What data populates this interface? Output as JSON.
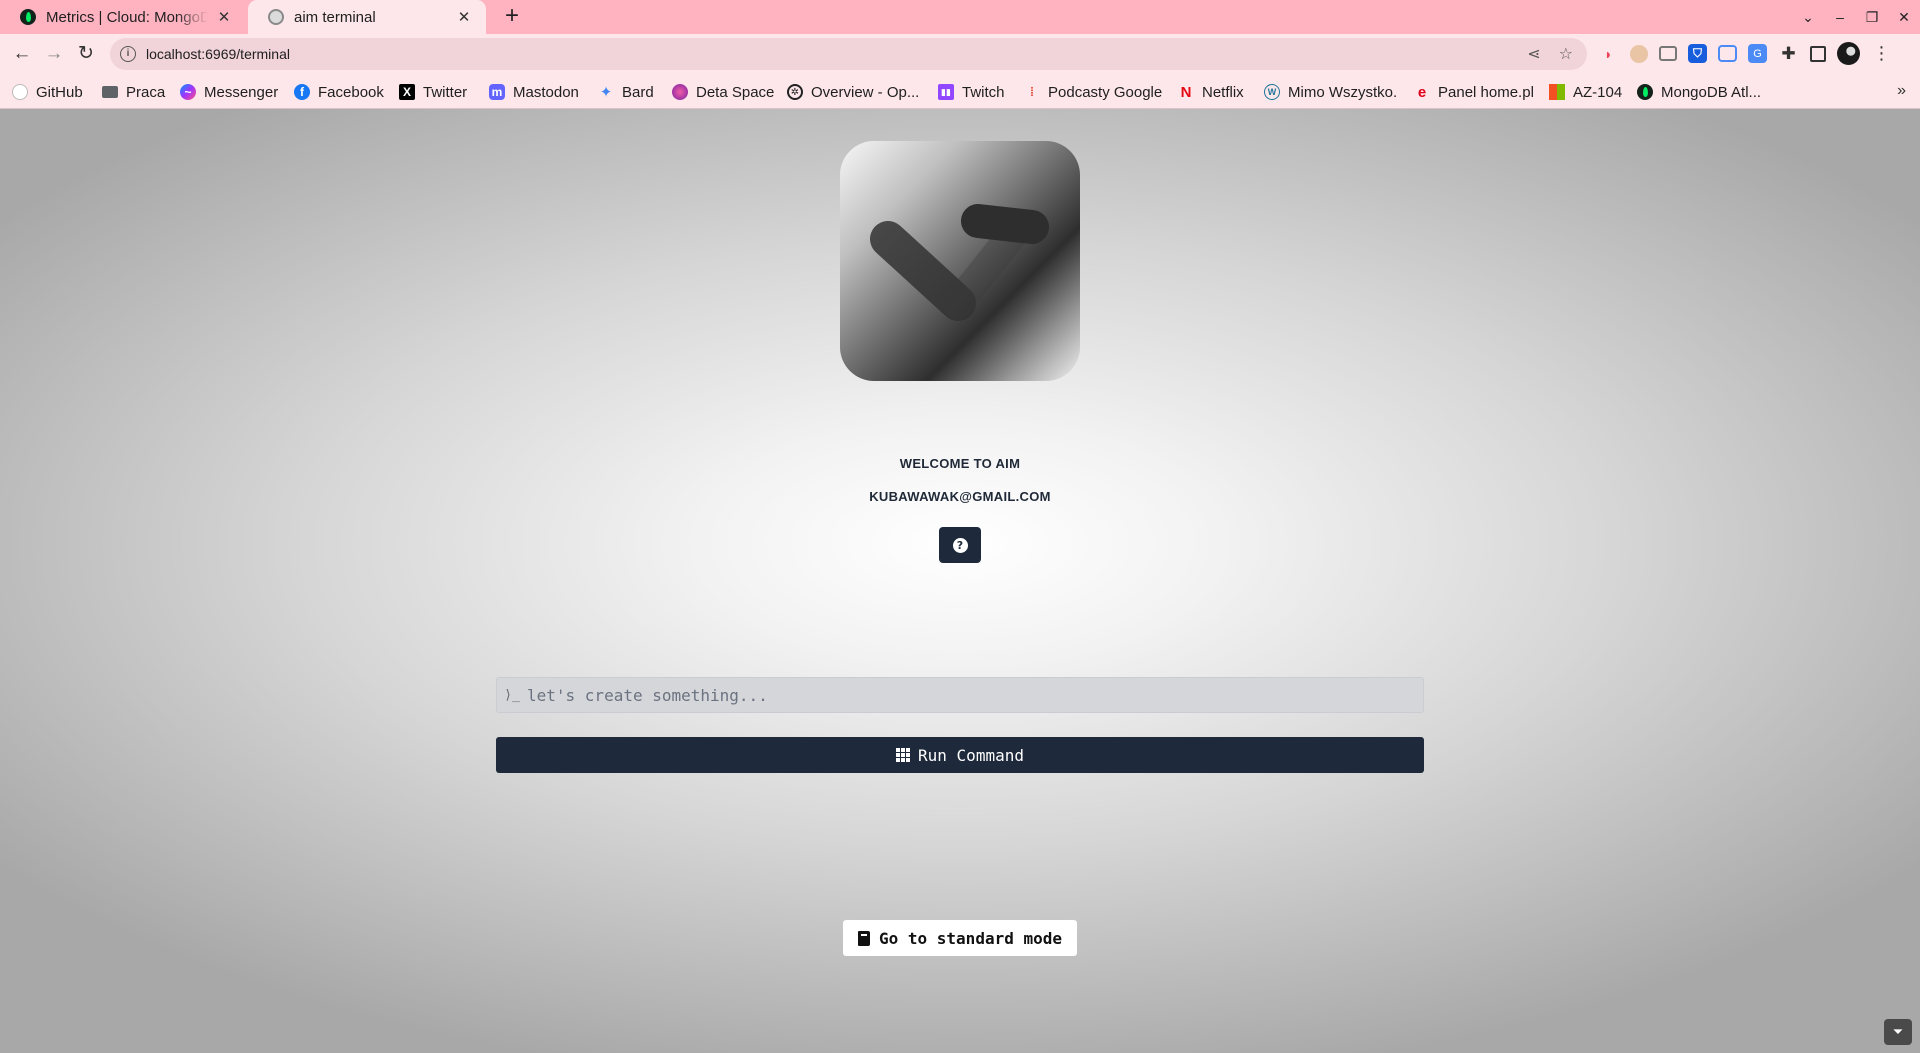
{
  "browser": {
    "tabs": [
      {
        "title": "Metrics | Cloud: MongoDB Cloud",
        "favicon": "mongodb-leaf-icon",
        "active": false
      },
      {
        "title": "aim terminal",
        "favicon": "globe-icon",
        "active": true
      }
    ],
    "address_bar": {
      "url": "localhost:6969/terminal"
    },
    "bookmarks": [
      {
        "label": "GitHub",
        "icon": "github-icon",
        "color": "#ffffff"
      },
      {
        "label": "Praca",
        "icon": "folder-icon",
        "color": "#5f6368"
      },
      {
        "label": "Messenger",
        "icon": "messenger-icon",
        "color": "#a033ff"
      },
      {
        "label": "Facebook",
        "icon": "facebook-icon",
        "color": "#1877f2"
      },
      {
        "label": "Twitter",
        "icon": "x-icon",
        "color": "#000000"
      },
      {
        "label": "Mastodon",
        "icon": "mastodon-icon",
        "color": "#6364ff"
      },
      {
        "label": "Bard",
        "icon": "bard-sparkle-icon",
        "color": "#4285f4"
      },
      {
        "label": "Deta Space",
        "icon": "deta-icon",
        "color": "#c2185b"
      },
      {
        "label": "Overview - Op...",
        "icon": "openai-icon",
        "color": "#202123"
      },
      {
        "label": "Twitch",
        "icon": "twitch-icon",
        "color": "#9146ff"
      },
      {
        "label": "Podcasty Google",
        "icon": "google-podcasts-icon",
        "color": "#ea4335"
      },
      {
        "label": "Netflix",
        "icon": "netflix-icon",
        "color": "#e50914"
      },
      {
        "label": "Mimo Wszystko.",
        "icon": "wordpress-icon",
        "color": "#21759b"
      },
      {
        "label": "Panel home.pl",
        "icon": "homepl-icon",
        "color": "#e2001a"
      },
      {
        "label": "AZ-104",
        "icon": "microsoft-icon",
        "color": "#f25022"
      },
      {
        "label": "MongoDB Atl...",
        "icon": "mongodb-leaf-icon",
        "color": "#00684a"
      }
    ]
  },
  "page": {
    "welcome": "WELCOME TO AIM",
    "email": "KUBAWAWAK@GMAIL.COM",
    "help_icon": "question-circle-icon",
    "command_input": {
      "value": "",
      "placeholder": "let's create something..."
    },
    "run_button": {
      "label": "Run Command"
    },
    "standard_mode_button": {
      "label": "Go to standard mode"
    }
  },
  "colors": {
    "accent_dark": "#1e293b",
    "tabstrip": "#ffb3c1",
    "toolbar": "#fde7ea"
  }
}
